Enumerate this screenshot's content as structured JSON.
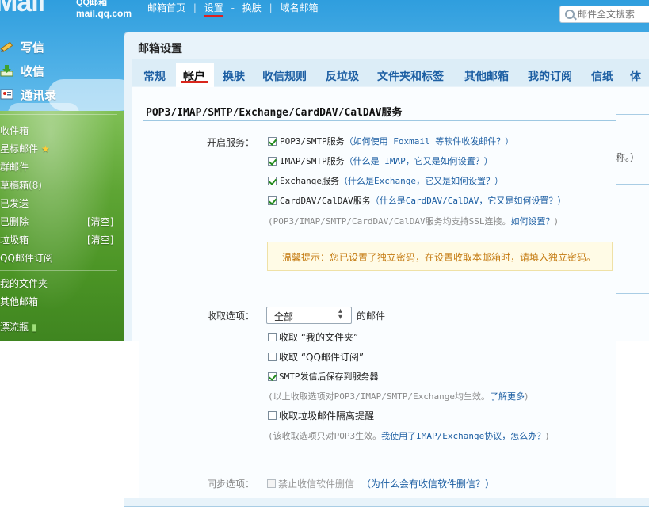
{
  "brand": {
    "logo_text": "Mail",
    "logo_sub": "mail.qq.com",
    "logo_sub_top": "QQ邮箱"
  },
  "topnav": {
    "home": "邮箱首页",
    "settings": "设置",
    "skin": "换肤",
    "domain_mail": "域名邮箱",
    "sep": "-",
    "sep2": "|"
  },
  "search": {
    "placeholder": "邮件全文搜索"
  },
  "sidebar": {
    "compose": "写信",
    "inbox": "收信",
    "contacts": "通讯录",
    "folders": [
      {
        "label": "收件箱"
      },
      {
        "label": "星标邮件"
      },
      {
        "label": "群邮件"
      },
      {
        "label": "草稿箱",
        "count": "(8)"
      },
      {
        "label": "已发送"
      },
      {
        "label": "已删除",
        "action": "[清空]"
      },
      {
        "label": "垃圾箱",
        "action": "[清空]"
      },
      {
        "label": "QQ邮件订阅"
      },
      {
        "label": "我的文件夹"
      },
      {
        "label": "其他邮箱"
      },
      {
        "label": "漂流瓶"
      }
    ]
  },
  "panel": {
    "title": "邮箱设置"
  },
  "tabs": [
    "常规",
    "帐户",
    "换肤",
    "收信规则",
    "反垃圾",
    "文件夹和标签",
    "其他邮箱",
    "我的订阅",
    "信纸",
    "体"
  ],
  "section": {
    "header": "POP3/IMAP/SMTP/Exchange/CardDAV/CalDAV服务"
  },
  "services": {
    "label": "开启服务：",
    "items": [
      {
        "name": "POP3/SMTP服务",
        "help": "（如何使用 Foxmail 等软件收发邮件？）",
        "checked": true
      },
      {
        "name": "IMAP/SMTP服务",
        "help": "（什么是 IMAP，它又是如何设置？）",
        "checked": true
      },
      {
        "name": "Exchange服务",
        "help": "（什么是Exchange，它又是如何设置？）",
        "checked": true
      },
      {
        "name": "CardDAV/CalDAV服务",
        "help": "（什么是CardDAV/CalDAV，它又是如何设置？）",
        "checked": true
      }
    ],
    "ssl_note": "(POP3/IMAP/SMTP/CardDAV/CalDAV服务均支持SSL连接。",
    "ssl_link": "如何设置？",
    "ssl_close": ")"
  },
  "tip": {
    "text": "温馨提示：您已设置了独立密码，在设置收取本邮箱时，请填入独立密码。"
  },
  "right_strip": {
    "text": "称。）"
  },
  "receive": {
    "label": "收取选项：",
    "select_value": "全部",
    "select_suffix": "的邮件",
    "opt_my_folders": "收取 “我的文件夹”",
    "opt_qq_sub": "收取 “QQ邮件订阅”",
    "opt_smtp_save": "SMTP发信后保存到服务器",
    "note1": "(以上收取选项对POP3/IMAP/SMTP/Exchange均生效。",
    "note1_link": "了解更多",
    "note1_close": ")",
    "opt_spam": "收取垃圾邮件隔离提醒",
    "note2": "(该收取选项只对POP3生效。",
    "note2_link": "我使用了IMAP/Exchange协议，怎么办？",
    "note2_close": ")"
  },
  "sync": {
    "label": "同步选项：",
    "opt_no_delete": "禁止收信软件删信",
    "help": "（为什么会有收信软件删信？）"
  },
  "colors": {
    "accent_red": "#d9261c",
    "link_blue": "#1d5fa3",
    "tip_orange": "#c47a10"
  }
}
